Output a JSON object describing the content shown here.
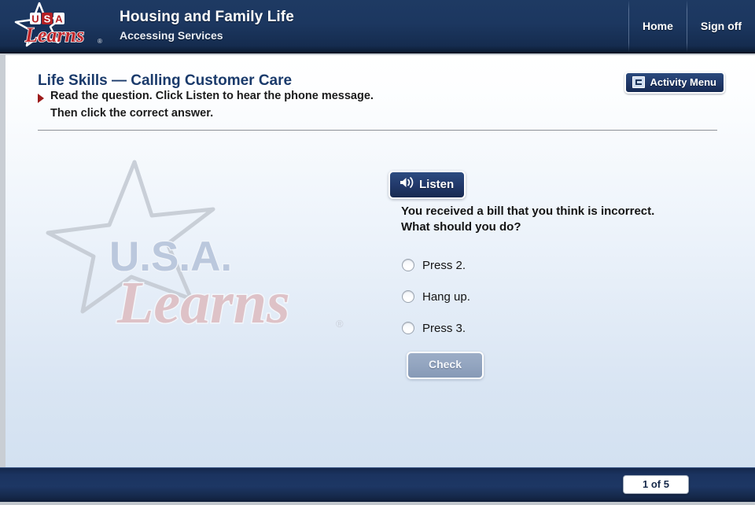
{
  "header": {
    "logo_alt": "USA Learns",
    "logo_word_top": "USA",
    "logo_word_bottom": "Learns",
    "logo_reg_mark": "®",
    "course_title": "Housing and Family Life",
    "course_subtitle": "Accessing Services",
    "nav": [
      {
        "label": "Home",
        "name": "nav-home"
      },
      {
        "label": "Sign off",
        "name": "nav-sign-off"
      }
    ],
    "colors": {
      "bar_top": "#1e3a63",
      "bar_bottom": "#0d1c33",
      "text": "#ffffff"
    }
  },
  "activity_menu": {
    "label": "Activity Menu",
    "icon": "menu-list-icon"
  },
  "page": {
    "title": "Life Skills — Calling Customer Care",
    "instruction_line_1": "Read the question. Click Listen to hear the phone message.",
    "instruction_line_2": "Then click the correct answer.",
    "bullet_color": "#9c1b1b",
    "title_color": "#1a3a6b"
  },
  "watermark": {
    "word_top": "U.S.A.",
    "word_bottom": "Learns",
    "reg_mark": "®",
    "star_stroke": "#c7ccd4",
    "word_top_color": "#b9c6dc",
    "word_bottom_color": "#e0b8bd"
  },
  "exercise": {
    "listen_button": {
      "label": "Listen",
      "icon": "speaker-icon"
    },
    "question": "You received a bill that you think is incorrect. What should you do?",
    "question_line_1": "You received a bill that you think is incorrect.",
    "question_line_2": "What should you do?",
    "options": [
      {
        "label": "Press 2.",
        "selected": false
      },
      {
        "label": "Hang up.",
        "selected": false
      },
      {
        "label": "Press 3.",
        "selected": false
      }
    ],
    "check_button": {
      "label": "Check",
      "enabled": false
    }
  },
  "footer": {
    "page_counter": "1 of 5"
  }
}
